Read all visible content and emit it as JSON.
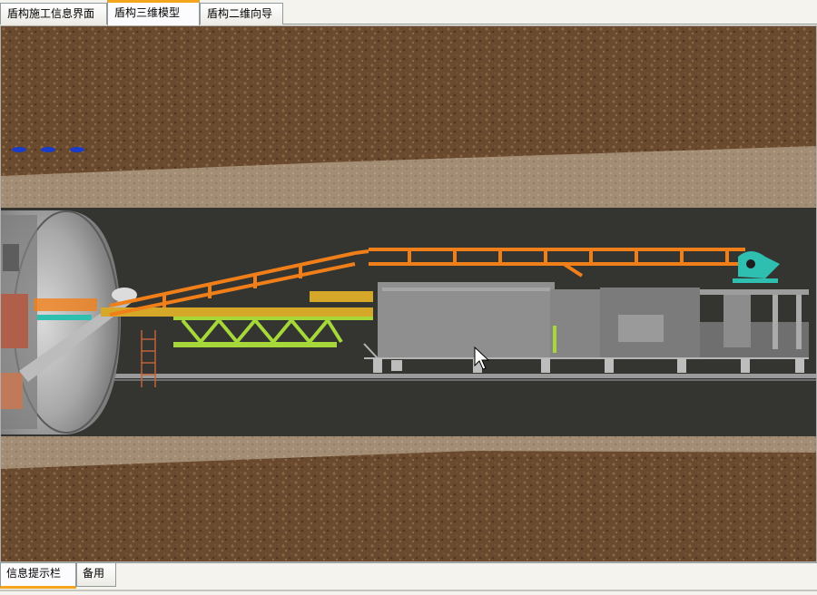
{
  "top_tabs": [
    {
      "label": "盾构施工信息界面",
      "active": false
    },
    {
      "label": "盾构三维模型",
      "active": true
    },
    {
      "label": "盾构二维向导",
      "active": false
    }
  ],
  "bottom_tabs": [
    {
      "label": "信息提示栏",
      "active": true
    },
    {
      "label": "备用",
      "active": false
    }
  ],
  "colors": {
    "soil": "#6b4a2f",
    "sand": "#a08a72",
    "tunnel": "#343531",
    "gantry": "#8f8f8f",
    "conveyor": "#f07f1a",
    "bridge": "#a6d83a",
    "cyan": "#2fbfb0",
    "tab_accent": "#f4a51c"
  }
}
